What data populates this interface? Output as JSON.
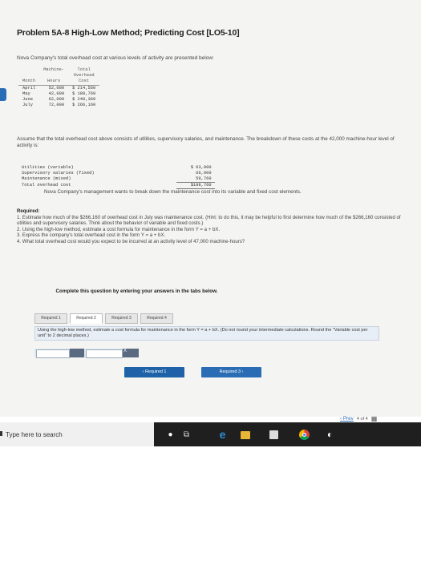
{
  "title": "Problem 5A-8 High-Low Method; Predicting Cost [LO5-10]",
  "intro": "Nova Company's total overhead cost at various levels of activity are presented below:",
  "activity_table": {
    "headers": [
      [
        "Month",
        ""
      ],
      [
        "Machine-",
        "Hours"
      ],
      [
        "Total",
        "Overhead",
        "Cost"
      ]
    ],
    "rows": [
      {
        "month": "April",
        "hours": "52,000",
        "cost": "$ 214,560"
      },
      {
        "month": "May",
        "hours": "42,000",
        "cost": "$ 188,760"
      },
      {
        "month": "June",
        "hours": "62,000",
        "cost": "$ 240,360"
      },
      {
        "month": "July",
        "hours": "72,000",
        "cost": "$ 266,160"
      }
    ]
  },
  "assume_text": "Assume that the total overhead cost above consists of utilities, supervisory salaries, and maintenance. The breakdown of these costs at the 42,000 machine-hour level of activity is:",
  "breakdown_table": [
    {
      "label": "Utilities (variable)",
      "amount": "$ 63,000"
    },
    {
      "label": "Supervisory salaries (fixed)",
      "amount": "66,000"
    },
    {
      "label": "Maintenance (mixed)",
      "amount": "59,760"
    },
    {
      "label": "Total overhead cost",
      "amount": "$188,760"
    }
  ],
  "management_text": "Nova Company's management wants to break down the maintenance cost into its variable and fixed cost elements.",
  "required": {
    "heading": "Required:",
    "items": [
      "1. Estimate how much of the $266,160 of overhead cost in July was maintenance cost. (Hint: to do this, it may be helpful to first determine how much of the $266,160 consisted of utilities and supervisory salaries. Think about the behavior of variable and fixed costs.)",
      "2. Using the high-low method, estimate a cost formula for maintenance in the form Y = a + bX.",
      "3. Express the company's total overhead cost in the form Y = a + bX.",
      "4. What total overhead cost would you expect to be incurred at an activity level of 47,000 machine-hours?"
    ]
  },
  "instruction": "Complete this question by entering your answers in the tabs below.",
  "tabs": [
    "Required 1",
    "Required 2",
    "Required 3",
    "Required 4"
  ],
  "tab_instruction": {
    "main": "Using the high-low method, estimate a cost formula for maintenance in the form Y = a + bX. (Do not round your intermediate calculations. Round the \"Variable cost per unit\" to 2 decimal places.)"
  },
  "formula_mark": "X",
  "nav": {
    "prev": "‹  Required 1",
    "next": "Required 3  ›"
  },
  "pager": {
    "prev": "‹  Prev",
    "count": "4 of 4"
  },
  "taskbar": {
    "search_placeholder": "Type here to search"
  },
  "icons": {
    "cortana": "microphone-icon",
    "taskview": "task-view-icon",
    "edge": "edge-icon",
    "folder": "folder-icon",
    "store": "store-icon",
    "chrome": "chrome-icon",
    "grid": "grid-icon"
  }
}
